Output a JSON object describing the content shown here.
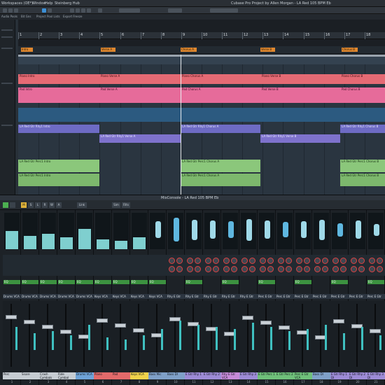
{
  "menubar": {
    "items": [
      "Workspaces (OE*)",
      "Window",
      "Help",
      "Steinberg Hub"
    ],
    "project_title": "Cubase Pro Project by Allen Morgan - LA Red 105 BPM Eb"
  },
  "tabs": [
    "Audio Pools",
    "Bit Gns",
    "Project Pool Lists",
    "Export Freeze"
  ],
  "ruler": {
    "bars": [
      "1",
      "2",
      "3",
      "4",
      "5",
      "6",
      "7",
      "8",
      "9",
      "10",
      "11",
      "12",
      "13",
      "14",
      "15",
      "16",
      "17",
      "18"
    ]
  },
  "markers": [
    {
      "label": "Intro"
    },
    {
      "label": "Verse A"
    },
    {
      "label": "Chorus A"
    },
    {
      "label": "Verse B"
    },
    {
      "label": "Chorus B"
    }
  ],
  "clips": {
    "piano": [
      "Piano Intro",
      "Piano Verse A",
      "Piano Chorus A",
      "Piano Verse B",
      "Piano Chorus B"
    ],
    "pad": [
      "Pad Intro",
      "Pad Verse A",
      "Pad Chorus A",
      "Pad Verse B",
      "Pad Chorus B"
    ],
    "rhy1": [
      "LA Red Gtr Rhy1 Intro",
      "LA Red Gtr Rhy1 Chorus A",
      "LA Red Gtr Rhy1 Chorus B"
    ],
    "rhy1b": [
      "LA Red Gtr Rhy1 Verse A",
      "LA Red Gtr Rhy1 Verse B"
    ],
    "perc1": [
      "LA Red Gtr Perc1 Intro",
      "LA Red Gtr Perc1 Chorus A",
      "LA Red Gtr Perc1 Chorus B"
    ],
    "perc1b": [
      "LA Red Gtr Perc1 Intro",
      "LA Red Gtr Perc1 Chorus A",
      "LA Red Gtr Perc1 Chorus B"
    ]
  },
  "mixconsole": {
    "title": "MixConsole - LA Red 105 BPM Eb",
    "toolbar": [
      "M",
      "S",
      "L",
      "R",
      "W",
      "A",
      "Link",
      "Sim",
      "Filts"
    ],
    "eq_label": "EQ",
    "channels": [
      {
        "name": "Drums VCA",
        "label": "Perc",
        "num": "1",
        "color": "#c6ccd2",
        "meter": 0.55
      },
      {
        "name": "Drums VCA",
        "label": "Snare",
        "num": "2",
        "color": "#c6ccd2",
        "meter": 0.4
      },
      {
        "name": "Drums VCA",
        "label": "Crash Cymbals",
        "num": "3",
        "color": "#c6ccd2",
        "meter": 0.45
      },
      {
        "name": "Drums VCA",
        "label": "Ride Cymbal",
        "num": "4",
        "color": "#c6ccd2",
        "meter": 0.35
      },
      {
        "name": "Drums VCA",
        "label": "Drums VCA",
        "num": "5",
        "color": "#6ea3d8",
        "meter": 0.6
      },
      {
        "name": "Keys VCA",
        "label": "Piano",
        "num": "6",
        "color": "#e26a6a",
        "meter": 0.3
      },
      {
        "name": "Keys VCA",
        "label": "Pad",
        "num": "7",
        "color": "#e26a6a",
        "meter": 0.25
      },
      {
        "name": "Keys VCA",
        "label": "Keys VCA",
        "num": "8",
        "color": "#f0d24a",
        "meter": 0.35
      },
      {
        "name": "Keys VCA",
        "label": "Bass Mic",
        "num": "9",
        "color": "#7fa0c8",
        "meter": 0.5
      },
      {
        "name": "Rhy E Gtr",
        "label": "Bass DI",
        "num": "10",
        "color": "#7fa0c8",
        "meter": 0.7
      },
      {
        "name": "Rhy E Gtr",
        "label": "E Gtr Rhy 1",
        "num": "11",
        "color": "#9d8bd6",
        "meter": 0.6
      },
      {
        "name": "Rhy E Gtr",
        "label": "E Gtr Rhy 2",
        "num": "12",
        "color": "#9d8bd6",
        "meter": 0.55
      },
      {
        "name": "Rhy E Gtr",
        "label": "Rhy E Gtr VCA",
        "num": "13",
        "color": "#c68ad8",
        "meter": 0.5
      },
      {
        "name": "Rhy E Gtr",
        "label": "E Gtr Rhy 3",
        "num": "14",
        "color": "#9d8bd6",
        "meter": 0.65
      },
      {
        "name": "Perc E Gtr",
        "label": "E Gtr Perc 1",
        "num": "15",
        "color": "#6fc07a",
        "meter": 0.55
      },
      {
        "name": "Perc E Gtr",
        "label": "E Gtr Perc 2",
        "num": "16",
        "color": "#6fc07a",
        "meter": 0.45
      },
      {
        "name": "Perc E Gtr",
        "label": "Perc E Gtr VCA",
        "num": "17",
        "color": "#6fc07a",
        "meter": 0.5
      },
      {
        "name": "Perc E Gtr",
        "label": "Bass DI",
        "num": "18",
        "color": "#7fa0c8",
        "meter": 0.6
      },
      {
        "name": "Perc E Gtr",
        "label": "E Gtr Rhy 1 DI",
        "num": "19",
        "color": "#9d8bd6",
        "meter": 0.4
      },
      {
        "name": "Perc E Gtr",
        "label": "E Gtr Rhy 2 DI",
        "num": "20",
        "color": "#9d8bd6",
        "meter": 0.55
      },
      {
        "name": "Perc E Gtr",
        "label": "E Gtr Rhy 3 DI",
        "num": "21",
        "color": "#9d8bd6",
        "meter": 0.35
      }
    ]
  }
}
